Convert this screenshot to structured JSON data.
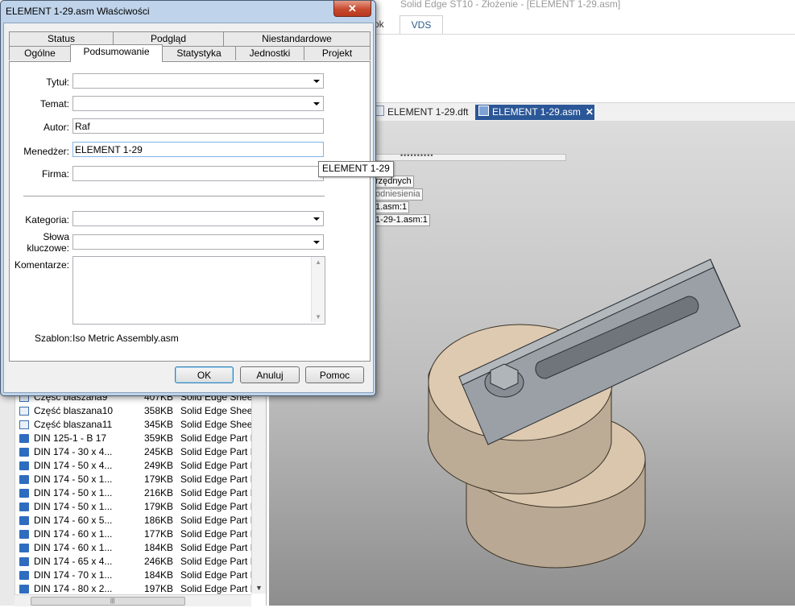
{
  "app": {
    "title": "Solid Edge ST10 - Złożenie - [ELEMENT 1-29.asm]",
    "ribbon_tabs": [
      "ok",
      "VDS"
    ],
    "doc_tabs": [
      {
        "label": "ELEMENT 1-29.dft"
      },
      {
        "label": "ELEMENT 1-29.asm",
        "close": "✕"
      }
    ],
    "progress_dots": "••••••••••",
    "tree_labels": [
      "rzędnych",
      "odniesienia",
      "1.asm:1",
      "1-29-1.asm:1"
    ]
  },
  "dialog": {
    "title": "ELEMENT 1-29.asm Właściwości",
    "close": "✕",
    "tabs_row1": [
      "Status",
      "Podgląd",
      "Niestandardowe"
    ],
    "tabs_row2": [
      "Ogólne",
      "Podsumowanie",
      "Statystyka",
      "Jednostki",
      "Projekt"
    ],
    "selected_tab": "Podsumowanie",
    "fields": {
      "title_label": "Tytuł:",
      "title_value": "",
      "subject_label": "Temat:",
      "subject_value": "",
      "author_label": "Autor:",
      "author_value": "Raf",
      "manager_label": "Menedżer:",
      "manager_value": "ELEMENT 1-29",
      "company_label": "Firma:",
      "company_value": "",
      "category_label": "Kategoria:",
      "category_value": "",
      "keywords_label_1": "Słowa",
      "keywords_label_2": "kluczowe:",
      "keywords_value": "",
      "comments_label": "Komentarze:",
      "comments_value": "",
      "template_label": "Szablon:",
      "template_value": "Iso Metric Assembly.asm"
    },
    "tooltip": "ELEMENT 1-29",
    "buttons": {
      "ok": "OK",
      "cancel": "Anuluj",
      "help": "Pomoc"
    }
  },
  "library": {
    "rows": [
      {
        "name": "Część blaszana9",
        "size": "407KB",
        "type": "Solid Edge Sheet",
        "icon": "sheet"
      },
      {
        "name": "Część blaszana10",
        "size": "358KB",
        "type": "Solid Edge Sheet",
        "icon": "sheet"
      },
      {
        "name": "Część blaszana11",
        "size": "345KB",
        "type": "Solid Edge Sheet",
        "icon": "sheet"
      },
      {
        "name": "DIN 125-1 - B 17",
        "size": "359KB",
        "type": "Solid Edge Part Do",
        "icon": "part"
      },
      {
        "name": "DIN 174 - 30 x 4...",
        "size": "245KB",
        "type": "Solid Edge Part Do",
        "icon": "part"
      },
      {
        "name": "DIN 174 - 50 x 4...",
        "size": "249KB",
        "type": "Solid Edge Part Do",
        "icon": "part"
      },
      {
        "name": "DIN 174 - 50 x 1...",
        "size": "179KB",
        "type": "Solid Edge Part Do",
        "icon": "part"
      },
      {
        "name": "DIN 174 - 50 x 1...",
        "size": "216KB",
        "type": "Solid Edge Part Do",
        "icon": "part"
      },
      {
        "name": "DIN 174 - 50 x 1...",
        "size": "179KB",
        "type": "Solid Edge Part Do",
        "icon": "part"
      },
      {
        "name": "DIN 174 - 60 x 5...",
        "size": "186KB",
        "type": "Solid Edge Part Do",
        "icon": "part"
      },
      {
        "name": "DIN 174 - 60 x 1...",
        "size": "177KB",
        "type": "Solid Edge Part Do",
        "icon": "part"
      },
      {
        "name": "DIN 174 - 60 x 1...",
        "size": "184KB",
        "type": "Solid Edge Part Do",
        "icon": "part"
      },
      {
        "name": "DIN 174 - 65 x 4...",
        "size": "246KB",
        "type": "Solid Edge Part Do",
        "icon": "part"
      },
      {
        "name": "DIN 174 - 70 x 1...",
        "size": "184KB",
        "type": "Solid Edge Part Do",
        "icon": "part"
      },
      {
        "name": "DIN 174 - 80 x 2...",
        "size": "197KB",
        "type": "Solid Edge Part Do",
        "icon": "part"
      }
    ],
    "scroll_down": "▼",
    "hscroll_grip": "|||"
  },
  "colors": {
    "dialog_frame": "#bfd3ea",
    "close_button": "#c74a2f",
    "active_doc_tab": "#2b5797",
    "disc": "#d9c6ad",
    "plate": "#9aa0a6"
  }
}
